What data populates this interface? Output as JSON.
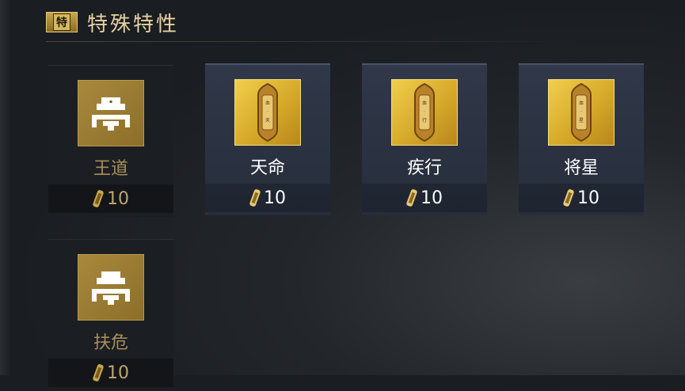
{
  "header": {
    "badge": "特",
    "title": "特殊特性"
  },
  "traits": [
    {
      "name": "王道",
      "cost": "10",
      "state": "inactive",
      "icon": "altar-icon"
    },
    {
      "name": "天命",
      "cost": "10",
      "state": "active",
      "icon": "tablet-icon"
    },
    {
      "name": "疾行",
      "cost": "10",
      "state": "active",
      "icon": "tablet-icon"
    },
    {
      "name": "将星",
      "cost": "10",
      "state": "active",
      "icon": "tablet-icon"
    },
    {
      "name": "扶危",
      "cost": "10",
      "state": "inactive",
      "icon": "altar-icon"
    }
  ],
  "colors": {
    "gold": "#e6d3a1",
    "active_card": "#2c3444",
    "inactive_card": "#1b1e23"
  }
}
